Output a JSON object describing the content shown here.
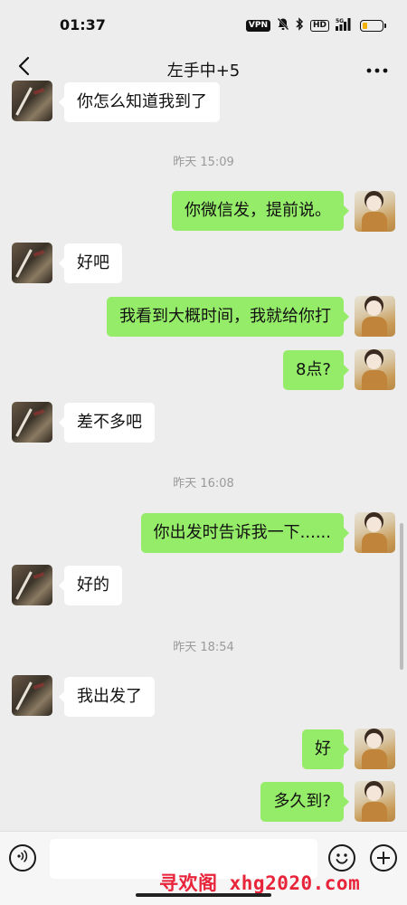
{
  "status_bar": {
    "time": "01:37",
    "vpn_label": "VPN",
    "hd_label": "HD",
    "network_label": "5G",
    "battery_level_fraction": 0.3
  },
  "header": {
    "title": "左手中+5",
    "back_icon": "chevron-left-icon",
    "more_icon": "more-dots-icon"
  },
  "messages": [
    {
      "side": "left",
      "text": "你怎么知道我到了"
    },
    {
      "type": "time",
      "text": "昨天 15:09"
    },
    {
      "side": "right",
      "text": "你微信发，提前说。"
    },
    {
      "side": "left",
      "text": "好吧"
    },
    {
      "side": "right",
      "text": "我看到大概时间，我就给你打"
    },
    {
      "side": "right",
      "text": "8点?"
    },
    {
      "side": "left",
      "text": "差不多吧"
    },
    {
      "type": "time",
      "text": "昨天 16:08"
    },
    {
      "side": "right",
      "text": "你出发时告诉我一下......"
    },
    {
      "side": "left",
      "text": "好的"
    },
    {
      "type": "time",
      "text": "昨天 18:54"
    },
    {
      "side": "left",
      "text": "我出发了"
    },
    {
      "side": "right",
      "text": "好"
    },
    {
      "side": "right",
      "text": "多久到?"
    }
  ],
  "input_bar": {
    "voice_icon": "voice-icon",
    "text_value": "",
    "emoji_icon": "emoji-icon",
    "plus_icon": "plus-icon"
  },
  "watermark": "寻欢阁 xhg2020.com",
  "colors": {
    "background": "#ededed",
    "bubble_sent": "#95ec69",
    "bubble_received": "#ffffff",
    "watermark": "#e8243a"
  }
}
